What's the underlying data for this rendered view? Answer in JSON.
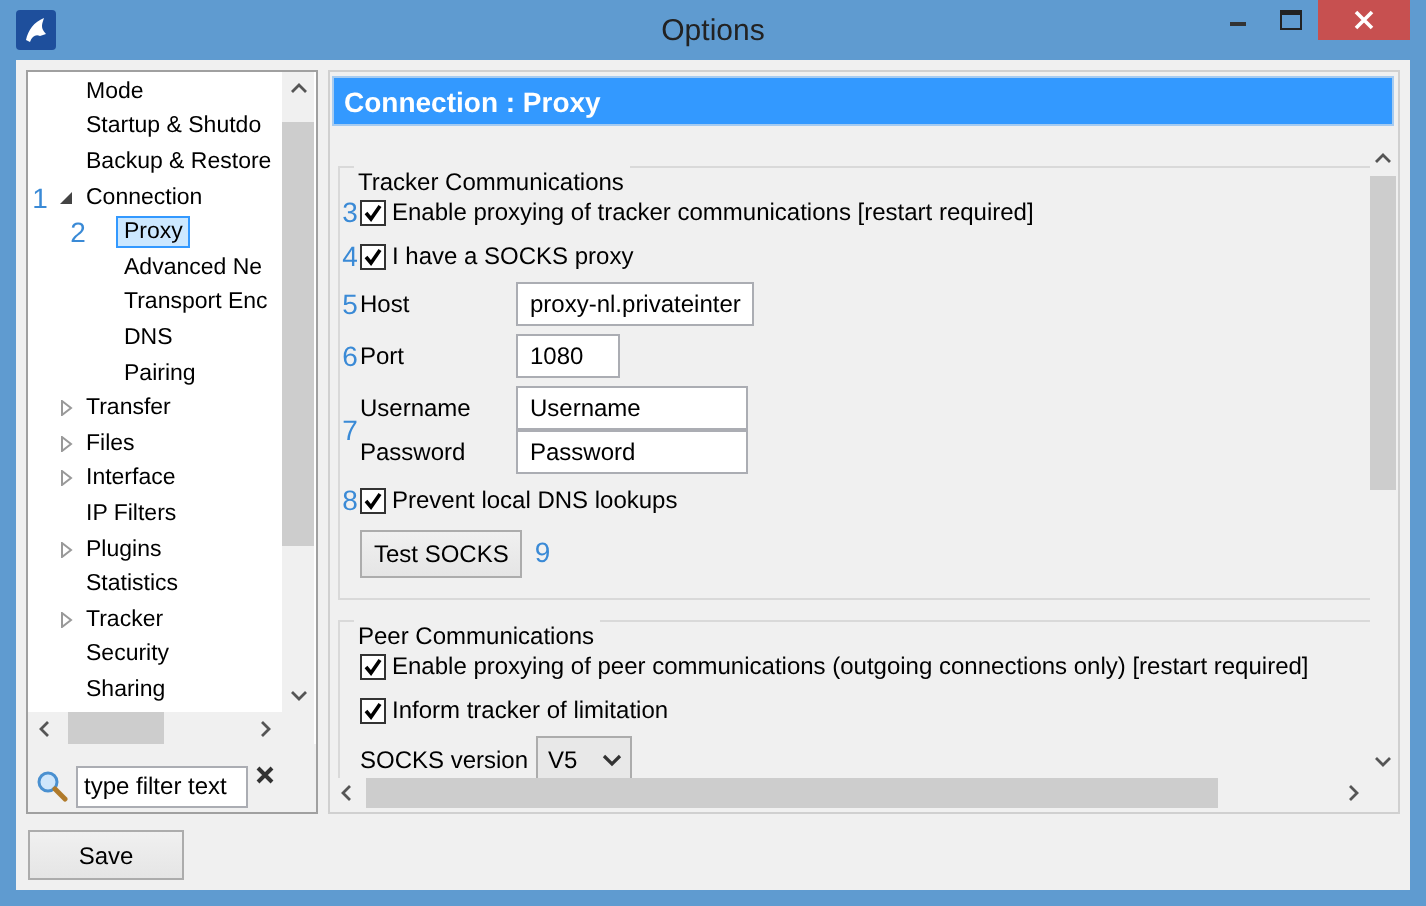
{
  "window": {
    "title": "Options"
  },
  "tree": {
    "items": [
      {
        "label": "Mode",
        "selected": false
      },
      {
        "label": "Startup & Shutdo",
        "selected": false
      },
      {
        "label": "Backup & Restore",
        "selected": false
      },
      {
        "label": "Connection",
        "expanded": true,
        "selected": false,
        "marker": "1",
        "children": [
          {
            "label": "Proxy",
            "selected": true,
            "marker": "2"
          },
          {
            "label": "Advanced Ne",
            "selected": false
          },
          {
            "label": "Transport Enc",
            "selected": false
          },
          {
            "label": "DNS",
            "selected": false
          },
          {
            "label": "Pairing",
            "selected": false
          }
        ]
      },
      {
        "label": "Transfer",
        "expanded": false,
        "selected": false
      },
      {
        "label": "Files",
        "expanded": false,
        "selected": false
      },
      {
        "label": "Interface",
        "expanded": false,
        "selected": false
      },
      {
        "label": "IP Filters",
        "selected": false
      },
      {
        "label": "Plugins",
        "expanded": false,
        "selected": false
      },
      {
        "label": "Statistics",
        "selected": false
      },
      {
        "label": "Tracker",
        "expanded": false,
        "selected": false
      },
      {
        "label": "Security",
        "selected": false
      },
      {
        "label": "Sharing",
        "selected": false
      }
    ]
  },
  "filter": {
    "placeholder": "type filter text"
  },
  "panel": {
    "title": "Connection : Proxy"
  },
  "tracker_communications": {
    "title": "Tracker Communications",
    "rows": [
      {
        "kind": "checkbox",
        "marker": "3",
        "label": "Enable proxying of tracker communications [restart required]",
        "checked": true
      },
      {
        "kind": "checkbox",
        "marker": "4",
        "label": "I have a SOCKS proxy",
        "checked": true
      },
      {
        "kind": "field",
        "marker": "5",
        "label": "Host",
        "value": "proxy-nl.privateinter"
      },
      {
        "kind": "field",
        "marker": "6",
        "label": "Port",
        "value": "1080"
      },
      {
        "kind": "field_pair",
        "marker": "7",
        "fields": [
          {
            "label": "Username",
            "value": "Username"
          },
          {
            "label": "Password",
            "value": "Password"
          }
        ]
      },
      {
        "kind": "checkbox",
        "marker": "8",
        "label": "Prevent local DNS lookups",
        "checked": true
      },
      {
        "kind": "button",
        "marker": "9",
        "label": "Test SOCKS"
      }
    ]
  },
  "peer_communications": {
    "title": "Peer Communications",
    "rows": [
      {
        "kind": "checkbox",
        "label": "Enable proxying of peer communications (outgoing connections only) [restart required]",
        "checked": true
      },
      {
        "kind": "checkbox",
        "label": "Inform tracker of limitation",
        "checked": true
      },
      {
        "kind": "select",
        "label": "SOCKS version",
        "value": "V5"
      }
    ]
  },
  "buttons": [
    "Save"
  ]
}
